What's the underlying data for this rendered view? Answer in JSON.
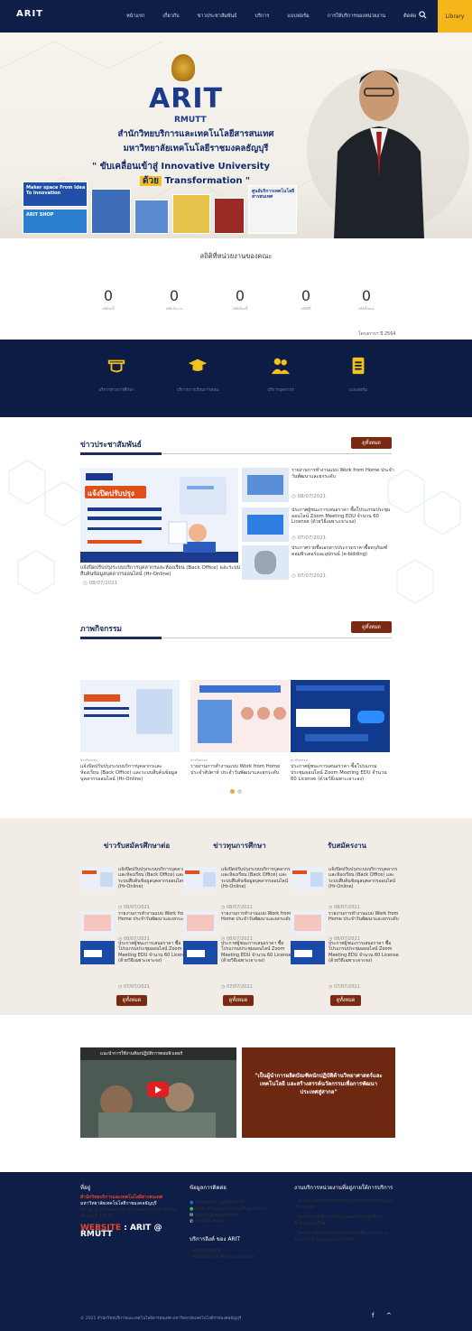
{
  "nav": {
    "logo": "ARIT",
    "items": [
      "หน้าแรก",
      "เกี่ยวกับ",
      "ข่าวประชาสัมพันธ์",
      "บริการ",
      "แบบฟอร์ม",
      "การให้บริการของหน่วยงาน",
      "ติดต่อ"
    ],
    "library_label": "Library"
  },
  "hero": {
    "brand": "ARIT",
    "brand_sub": "RMUTT",
    "title_line1": "สำนักวิทยบริการและเทคโนโลยีสารสนเทศ",
    "title_line2": "มหาวิทยาลัยเทคโนโลยีราชมงคลธัญบุรี",
    "slogan_line1": "\" ขับเคลื่อนเข้าสู่ Innovative University",
    "slogan_hl": "ด้วย",
    "slogan_line2": "Transformation \"",
    "card1": "Maker space From Idea To Innovation",
    "card2": "ARIT SHOP",
    "card3": "ศูนย์บริการเทคโนโลยีสารสนเทศ"
  },
  "stats": {
    "title": "สถิติที่หน่วยงานของคณะ",
    "items": [
      {
        "value": "0",
        "label": "สถิติวันนี้"
      },
      {
        "value": "0",
        "label": "สถิติเมื่อวาน"
      },
      {
        "value": "0",
        "label": "สถิติเดือนนี้"
      },
      {
        "value": "0",
        "label": "สถิติปีนี้"
      },
      {
        "value": "0",
        "label": "สถิติทั้งหมด"
      }
    ],
    "note": "โครงการฯ ปี 2564"
  },
  "services": [
    {
      "label": "บริการทางการศึกษา",
      "icon": "graduation-icon"
    },
    {
      "label": "บริการการเรียนการสอน",
      "icon": "cap-icon"
    },
    {
      "label": "บริการบุคลากร",
      "icon": "users-icon"
    },
    {
      "label": "แบบฟอร์ม",
      "icon": "document-icon"
    }
  ],
  "news": {
    "title": "ข่าวประชาสัมพันธ์",
    "more": "ดูทั้งหมด",
    "featured": {
      "image_title": "แจ้งปิดปรับปรุง",
      "caption": "แจ้งปิดปรับปรุงระบบบริการบุคลากรและห้องเรียน (Back Office) และระบบสืบค้นข้อมูลบุคลากรออนไลน์ (Hr-Online)",
      "date": "08/07/2021"
    },
    "side": [
      {
        "text": "รายงานการทำงานแบบ Work from Home ประจำวันพัฒนาและยกระดับ",
        "date": "08/07/2021"
      },
      {
        "text": "ประกาศผู้ชนะการเสนอราคา ซื้อโปรแกรมประชุมออนไลน์ Zoom Meeting EDU จำนวน 60 License (ด้วยวิธีเฉพาะเจาะจง)",
        "date": "07/07/2021"
      },
      {
        "text": "ประกาศรายชื่อเอกสารประกวดราคาซื้อครุภัณฑ์คอมพิวเตอร์และอุปกรณ์ (e-bidding)",
        "date": "07/07/2021"
      }
    ]
  },
  "activities": {
    "title": "ภาพกิจกรรม",
    "more": "ดูทั้งหมด",
    "items": [
      {
        "category": "ข่าวกิจกรรม",
        "title": "แจ้งปิดปรับปรุงระบบบริการบุคลากรและห้องเรียน (Back Office) และระบบสืบค้นข้อมูลบุคลากรออนไลน์ (Hr-Online)"
      },
      {
        "category": "ข่าวกิจกรรม",
        "title": "รายงานการทำงานแบบ Work from Home ประจำสัปดาห์ ประจำวันพัฒนาและยกระดับ"
      },
      {
        "category": "ข่าวกิจกรรม",
        "title": "ประกาศผู้ชนะการเสนอราคา ซื้อโปรแกรมประชุมออนไลน์ Zoom Meeting EDU จำนวน 60 License (ด้วยวิธีเฉพาะเจาะจง)"
      }
    ]
  },
  "columns": [
    {
      "title": "ข่าวรับสมัครศึกษาต่อ",
      "more": "ดูทั้งหมด"
    },
    {
      "title": "ข่าวทุนการศึกษา",
      "more": "ดูทั้งหมด"
    },
    {
      "title": "รับสมัครงาน",
      "more": "ดูทั้งหมด"
    }
  ],
  "column_items": [
    {
      "text": "แจ้งปิดปรับปรุงระบบบริการบุคลากรและห้องเรียน (Back Office) และระบบสืบค้นข้อมูลบุคลากรออนไลน์ (Hr-Online)",
      "date": "08/07/2021"
    },
    {
      "text": "รายงานการทำงานแบบ Work from Home ประจำวันพัฒนาและยกระดับ",
      "date": "08/07/2021"
    },
    {
      "text": "ประกาศผู้ชนะการเสนอราคา ซื้อโปรแกรมประชุมออนไลน์ Zoom Meeting EDU จำนวน 60 License (ด้วยวิธีเฉพาะเจาะจง)",
      "date": "07/07/2021"
    }
  ],
  "video": {
    "title": "แนะนำการใช้งานห้องปฏิบัติการคอมพิวเตอร์"
  },
  "quote": "\"เป็นผู้นำการผลิตบัณฑิตนักปฏิบัติด้านวิทยาศาสตร์และเทคโนโลยี และสร้างสรรค์นวัตกรรมเพื่อการพัฒนาประเทศสู่สากล\"",
  "footer": {
    "addr_title": "ที่อยู่",
    "addr_name": "สำนักวิทยบริการและเทคโนโลยีสารสนเทศ",
    "addr_uni": "มหาวิทยาลัยเทคโนโลยีราชมงคลธัญบุรี",
    "addr_line": "39 หมู่ 1 ตำบลคลองหก อำเภอคลองหลวง จังหวัดปทุมธานี 12110",
    "website_label": "WEBSITE",
    "website_a": "ARIT",
    "website_b": "RMUTT",
    "contact_title": "ข้อมูลการติดต่อ",
    "contacts": [
      "Facebook : AritRMUTT",
      "Line : https://line.me/R/aritrmutt",
      "admin@rmutt.ac.th",
      "0 2549 4004"
    ],
    "links_title": "บริการลิงค์ ของ ARIT",
    "links": [
      "ศูนย์ข้อมูลสถิติ",
      "ศูนย์บริการนักศึกษาและบุคลากร"
    ],
    "units_title": "งานบริการหน่วยงานที่อยู่ภายใต้การบริการ",
    "units": [
      "โครงการส่งเสริมและพัฒนาผู้เรียนด้านเทคโนโลยีสารสนเทศ",
      "ศูนย์บริการเพื่อการเรียนรู้และห้องสมุดเพื่อการศึกษาตลอดชีวิต",
      "โครงการพัฒนาระบบสารสนเทศเพื่อการบริหารจัดการ (ทั้งในและนอกสถานที่)"
    ],
    "copyright": "© 2021 สำนักวิทยบริการและเทคโนโลยีสารสนเทศ มหาวิทยาลัยเทคโนโลยีราชมงคลธัญบุรี",
    "to_top": "^"
  },
  "colors": {
    "navy": "#0f1e46",
    "gold": "#f5b61a",
    "brown": "#7a2a10"
  }
}
